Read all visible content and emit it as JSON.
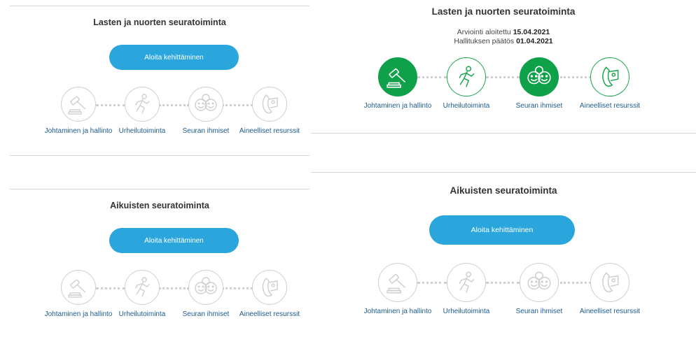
{
  "panels": {
    "youth_small": {
      "title": "Lasten ja nuorten seuratoiminta",
      "button": "Aloita kehittäminen"
    },
    "youth_large": {
      "title": "Lasten ja nuorten seuratoiminta",
      "info_line1_prefix": "Arviointi aloitettu",
      "info_line1_date": "15.04.2021",
      "info_line2_prefix": "Hallituksen päätös",
      "info_line2_date": "01.04.2021"
    },
    "adult_small": {
      "title": "Aikuisten seuratoiminta",
      "button": "Aloita kehittäminen"
    },
    "adult_large": {
      "title": "Aikuisten seuratoiminta",
      "button": "Aloita kehittäminen"
    }
  },
  "steps": [
    {
      "label": "Johtaminen ja hallinto",
      "icon": "gavel-icon"
    },
    {
      "label": "Urheilutoiminta",
      "icon": "runner-icon"
    },
    {
      "label": "Seuran ihmiset",
      "icon": "people-icon"
    },
    {
      "label": "Aineelliset resurssit",
      "icon": "flag-resource-icon"
    }
  ],
  "colors": {
    "accent_blue": "#2aa6dd",
    "active_green": "#0fa04a",
    "inactive_gray": "#cfcfcf",
    "label_blue": "#1c5b8f"
  },
  "youth_large_step_states": [
    "completed",
    "outline",
    "completed",
    "outline"
  ]
}
